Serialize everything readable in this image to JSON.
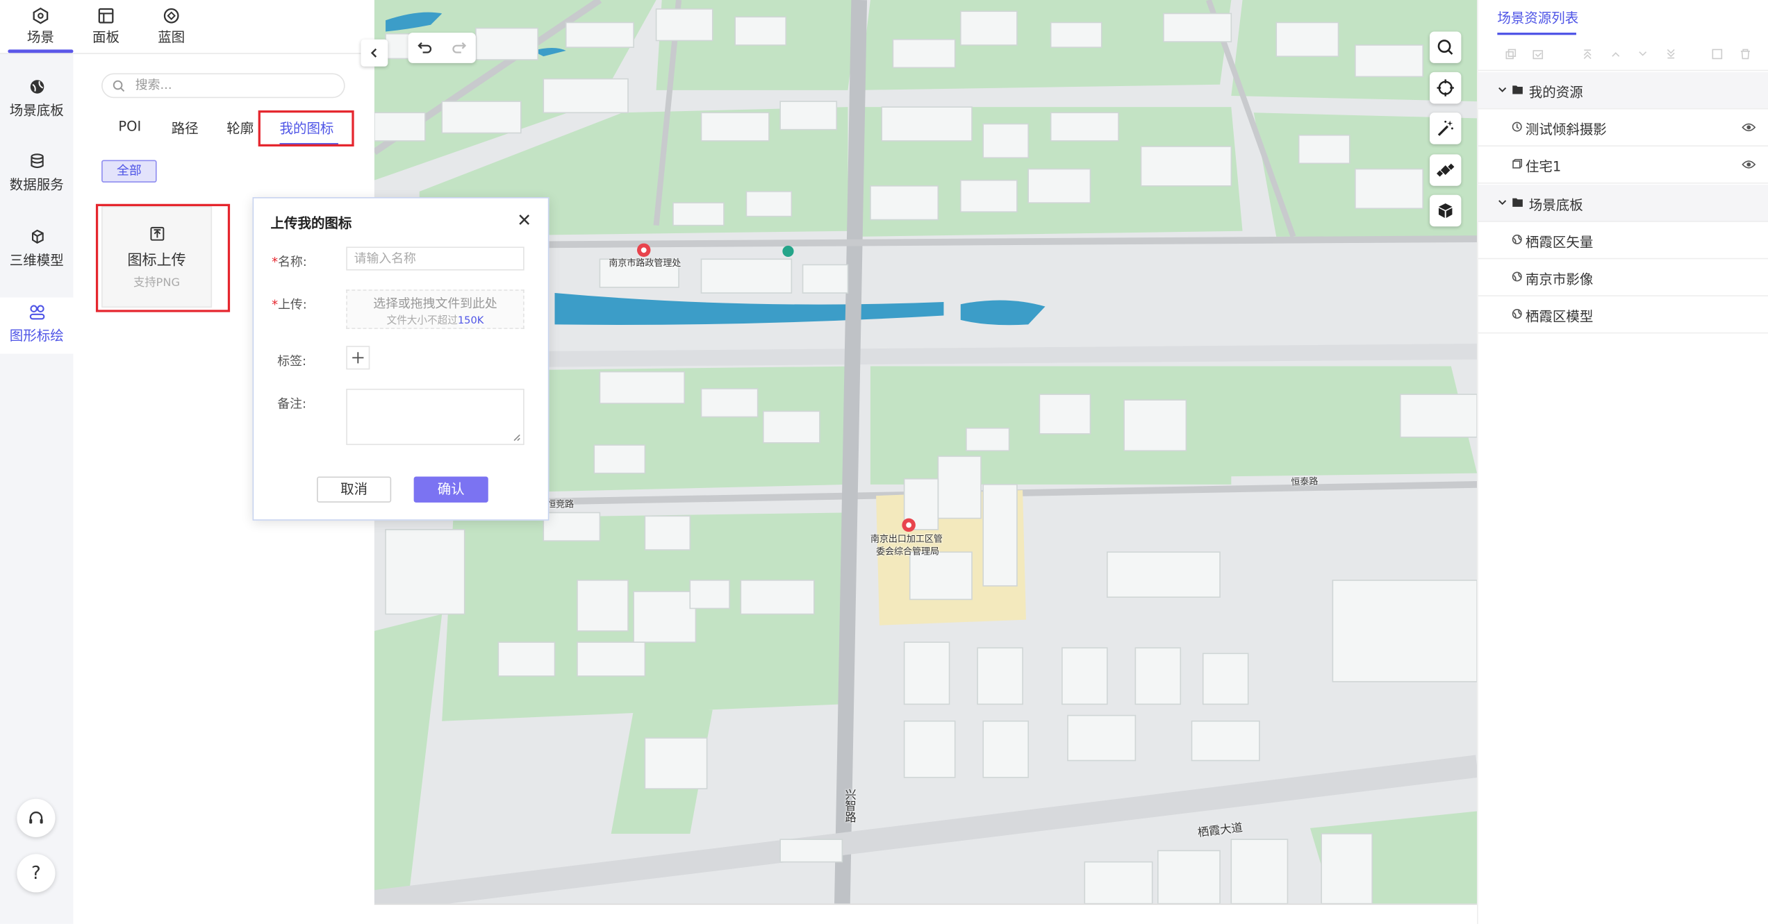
{
  "top_tabs": [
    {
      "label": "场景",
      "icon": "scene-icon"
    },
    {
      "label": "面板",
      "icon": "panel-icon"
    },
    {
      "label": "蓝图",
      "icon": "blueprint-icon"
    }
  ],
  "rail": {
    "items": [
      {
        "label": "场景底板",
        "icon": "globe-icon"
      },
      {
        "label": "数据服务",
        "icon": "database-icon"
      },
      {
        "label": "三维模型",
        "icon": "cube-icon"
      },
      {
        "label": "图形标绘",
        "icon": "shapes-icon"
      }
    ],
    "help_symbol": "?"
  },
  "left_panel": {
    "search_placeholder": "搜索...",
    "categories": [
      "POI",
      "路径",
      "轮廓",
      "我的图标"
    ],
    "filter_all": "全部",
    "upload_card": {
      "title": "图标上传",
      "hint": "支持PNG"
    }
  },
  "dialog": {
    "title": "上传我的图标",
    "name_label": "名称:",
    "name_placeholder": "请输入名称",
    "upload_label": "上传:",
    "upload_text": "选择或拖拽文件到此处",
    "upload_limit_text": "文件大小不超过",
    "upload_limit_value": "150K",
    "tag_label": "标签:",
    "note_label": "备注:",
    "cancel": "取消",
    "confirm": "确认",
    "required_mark": "*"
  },
  "map": {
    "labels": {
      "road_mgmt": "南京市路政管理处",
      "zone_mgmt_line1": "南京出口加工区管",
      "zone_mgmt_line2": "委会综合管理局",
      "road_xingzhi": "兴智路",
      "road_qixia": "栖霞大道",
      "road_hengtai": "恒泰路",
      "road_hengjing": "恒竞路"
    }
  },
  "right_panel": {
    "title": "场景资源列表",
    "groups": [
      {
        "name": "我的资源",
        "items": [
          {
            "name": "测试倾斜摄影",
            "icon": "oblique-photo-icon",
            "visible": true
          },
          {
            "name": "住宅1",
            "icon": "model-icon",
            "visible": true
          }
        ]
      },
      {
        "name": "场景底板",
        "items": [
          {
            "name": "栖霞区矢量",
            "icon": "layer-icon"
          },
          {
            "name": "南京市影像",
            "icon": "layer-icon"
          },
          {
            "name": "栖霞区模型",
            "icon": "layer-icon"
          }
        ]
      }
    ]
  },
  "colors": {
    "accent": "#4e54e6",
    "highlight": "#e5262e",
    "confirm": "#7b73f2",
    "green": "#bfe1c0",
    "water": "#3c9dc8"
  }
}
